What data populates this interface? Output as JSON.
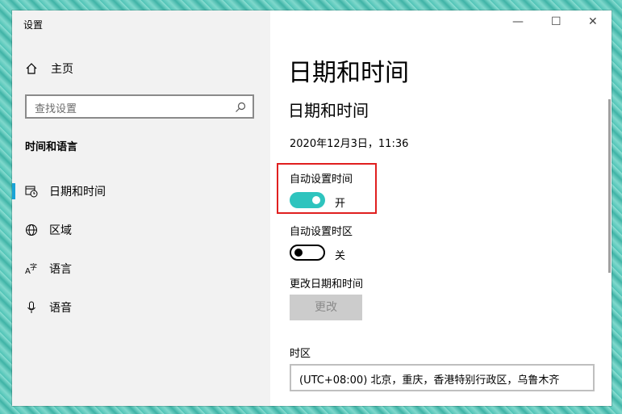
{
  "window": {
    "title": "设置",
    "controls": {
      "minimize": "—",
      "maximize": "☐",
      "close": "✕"
    }
  },
  "sidebar": {
    "home_label": "主页",
    "search_placeholder": "查找设置",
    "section_title": "时间和语言",
    "items": [
      {
        "label": "日期和时间",
        "icon": "calendar-clock-icon",
        "active": true
      },
      {
        "label": "区域",
        "icon": "globe-icon",
        "active": false
      },
      {
        "label": "语言",
        "icon": "language-icon",
        "active": false
      },
      {
        "label": "语音",
        "icon": "microphone-icon",
        "active": false
      }
    ]
  },
  "main": {
    "page_title": "日期和时间",
    "section_title": "日期和时间",
    "current_datetime": "2020年12月3日，11:36",
    "auto_time": {
      "label": "自动设置时间",
      "state_text": "开",
      "on": true
    },
    "auto_timezone": {
      "label": "自动设置时区",
      "state_text": "关",
      "on": false
    },
    "change_datetime": {
      "label": "更改日期和时间",
      "button": "更改"
    },
    "timezone": {
      "label": "时区",
      "value": "(UTC+08:00) 北京，重庆，香港特别行政区，乌鲁木齐"
    }
  },
  "colors": {
    "accent": "#2ec4be",
    "highlight_border": "#e01f1f",
    "sidebar_bg": "#f2f2f2"
  }
}
